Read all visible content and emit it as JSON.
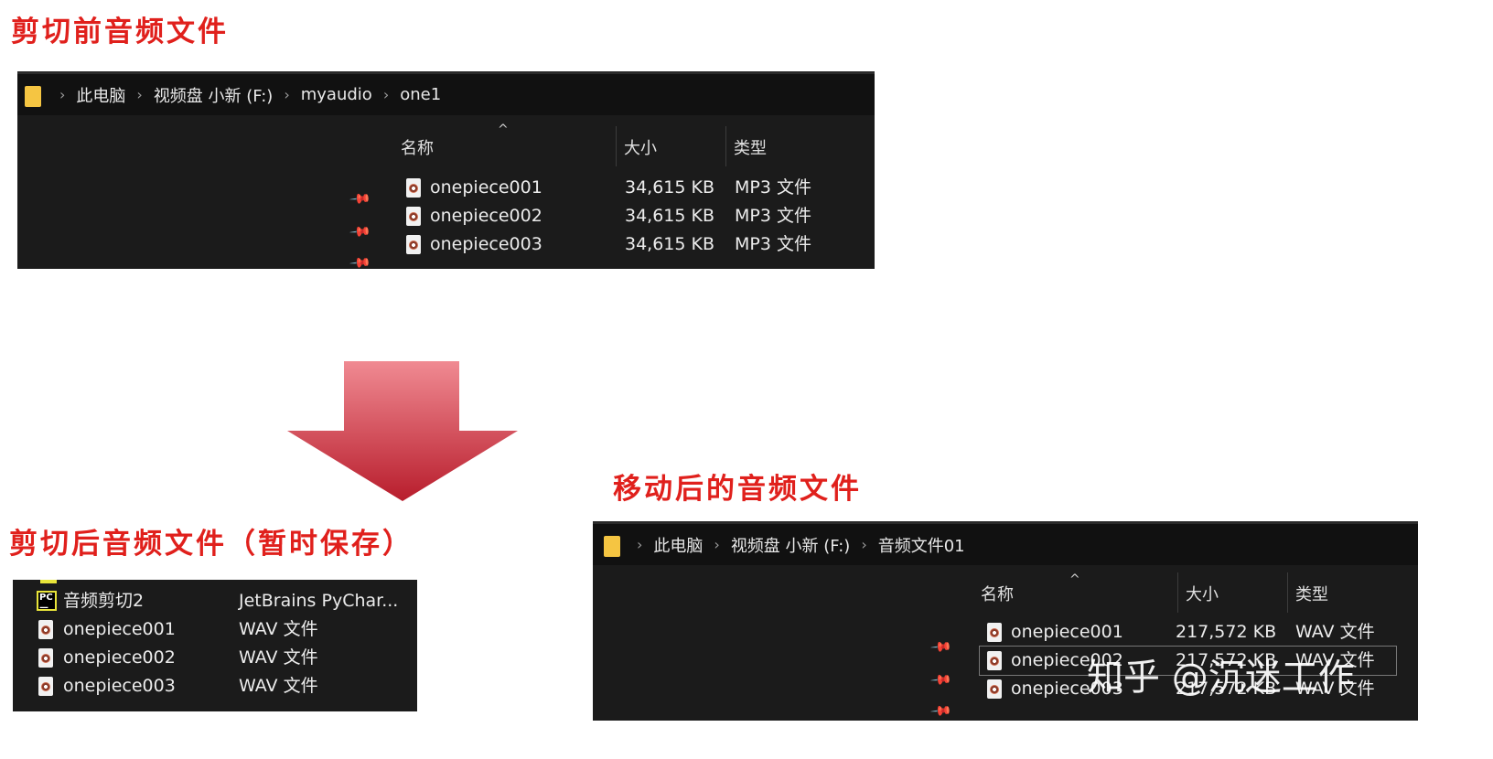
{
  "captions": {
    "before": "剪切前音频文件",
    "cut_temp": "剪切后音频文件（暂时保存）",
    "after": "移动后的音频文件"
  },
  "explorer_before": {
    "breadcrumb": [
      "此电脑",
      "视频盘 小新 (F:)",
      "myaudio",
      "one1"
    ],
    "columns": {
      "name": "名称",
      "size": "大小",
      "type": "类型"
    },
    "files": [
      {
        "name": "onepiece001",
        "size": "34,615 KB",
        "type": "MP3 文件"
      },
      {
        "name": "onepiece002",
        "size": "34,615 KB",
        "type": "MP3 文件"
      },
      {
        "name": "onepiece003",
        "size": "34,615 KB",
        "type": "MP3 文件"
      }
    ]
  },
  "explorer_temp": {
    "files": [
      {
        "name": "音频剪切2",
        "type": "JetBrains PyChar...",
        "icon": "pycharm-icon"
      },
      {
        "name": "onepiece001",
        "type": "WAV 文件",
        "icon": "audio-file-icon"
      },
      {
        "name": "onepiece002",
        "type": "WAV 文件",
        "icon": "audio-file-icon"
      },
      {
        "name": "onepiece003",
        "type": "WAV 文件",
        "icon": "audio-file-icon"
      }
    ]
  },
  "explorer_after": {
    "breadcrumb": [
      "此电脑",
      "视频盘 小新 (F:)",
      "音频文件01"
    ],
    "columns": {
      "name": "名称",
      "size": "大小",
      "type": "类型"
    },
    "files": [
      {
        "name": "onepiece001",
        "size": "217,572 KB",
        "type": "WAV 文件"
      },
      {
        "name": "onepiece002",
        "size": "217,572 KB",
        "type": "WAV 文件"
      },
      {
        "name": "onepiece003",
        "size": "217,572 KB",
        "type": "WAV 文件"
      }
    ]
  },
  "watermark": "知乎 @沉迷工作",
  "colors": {
    "caption": "#e0201c",
    "arrow_top": "#f08a92",
    "arrow_bottom": "#b81d2c",
    "explorer_bg": "#1b1b1b"
  }
}
